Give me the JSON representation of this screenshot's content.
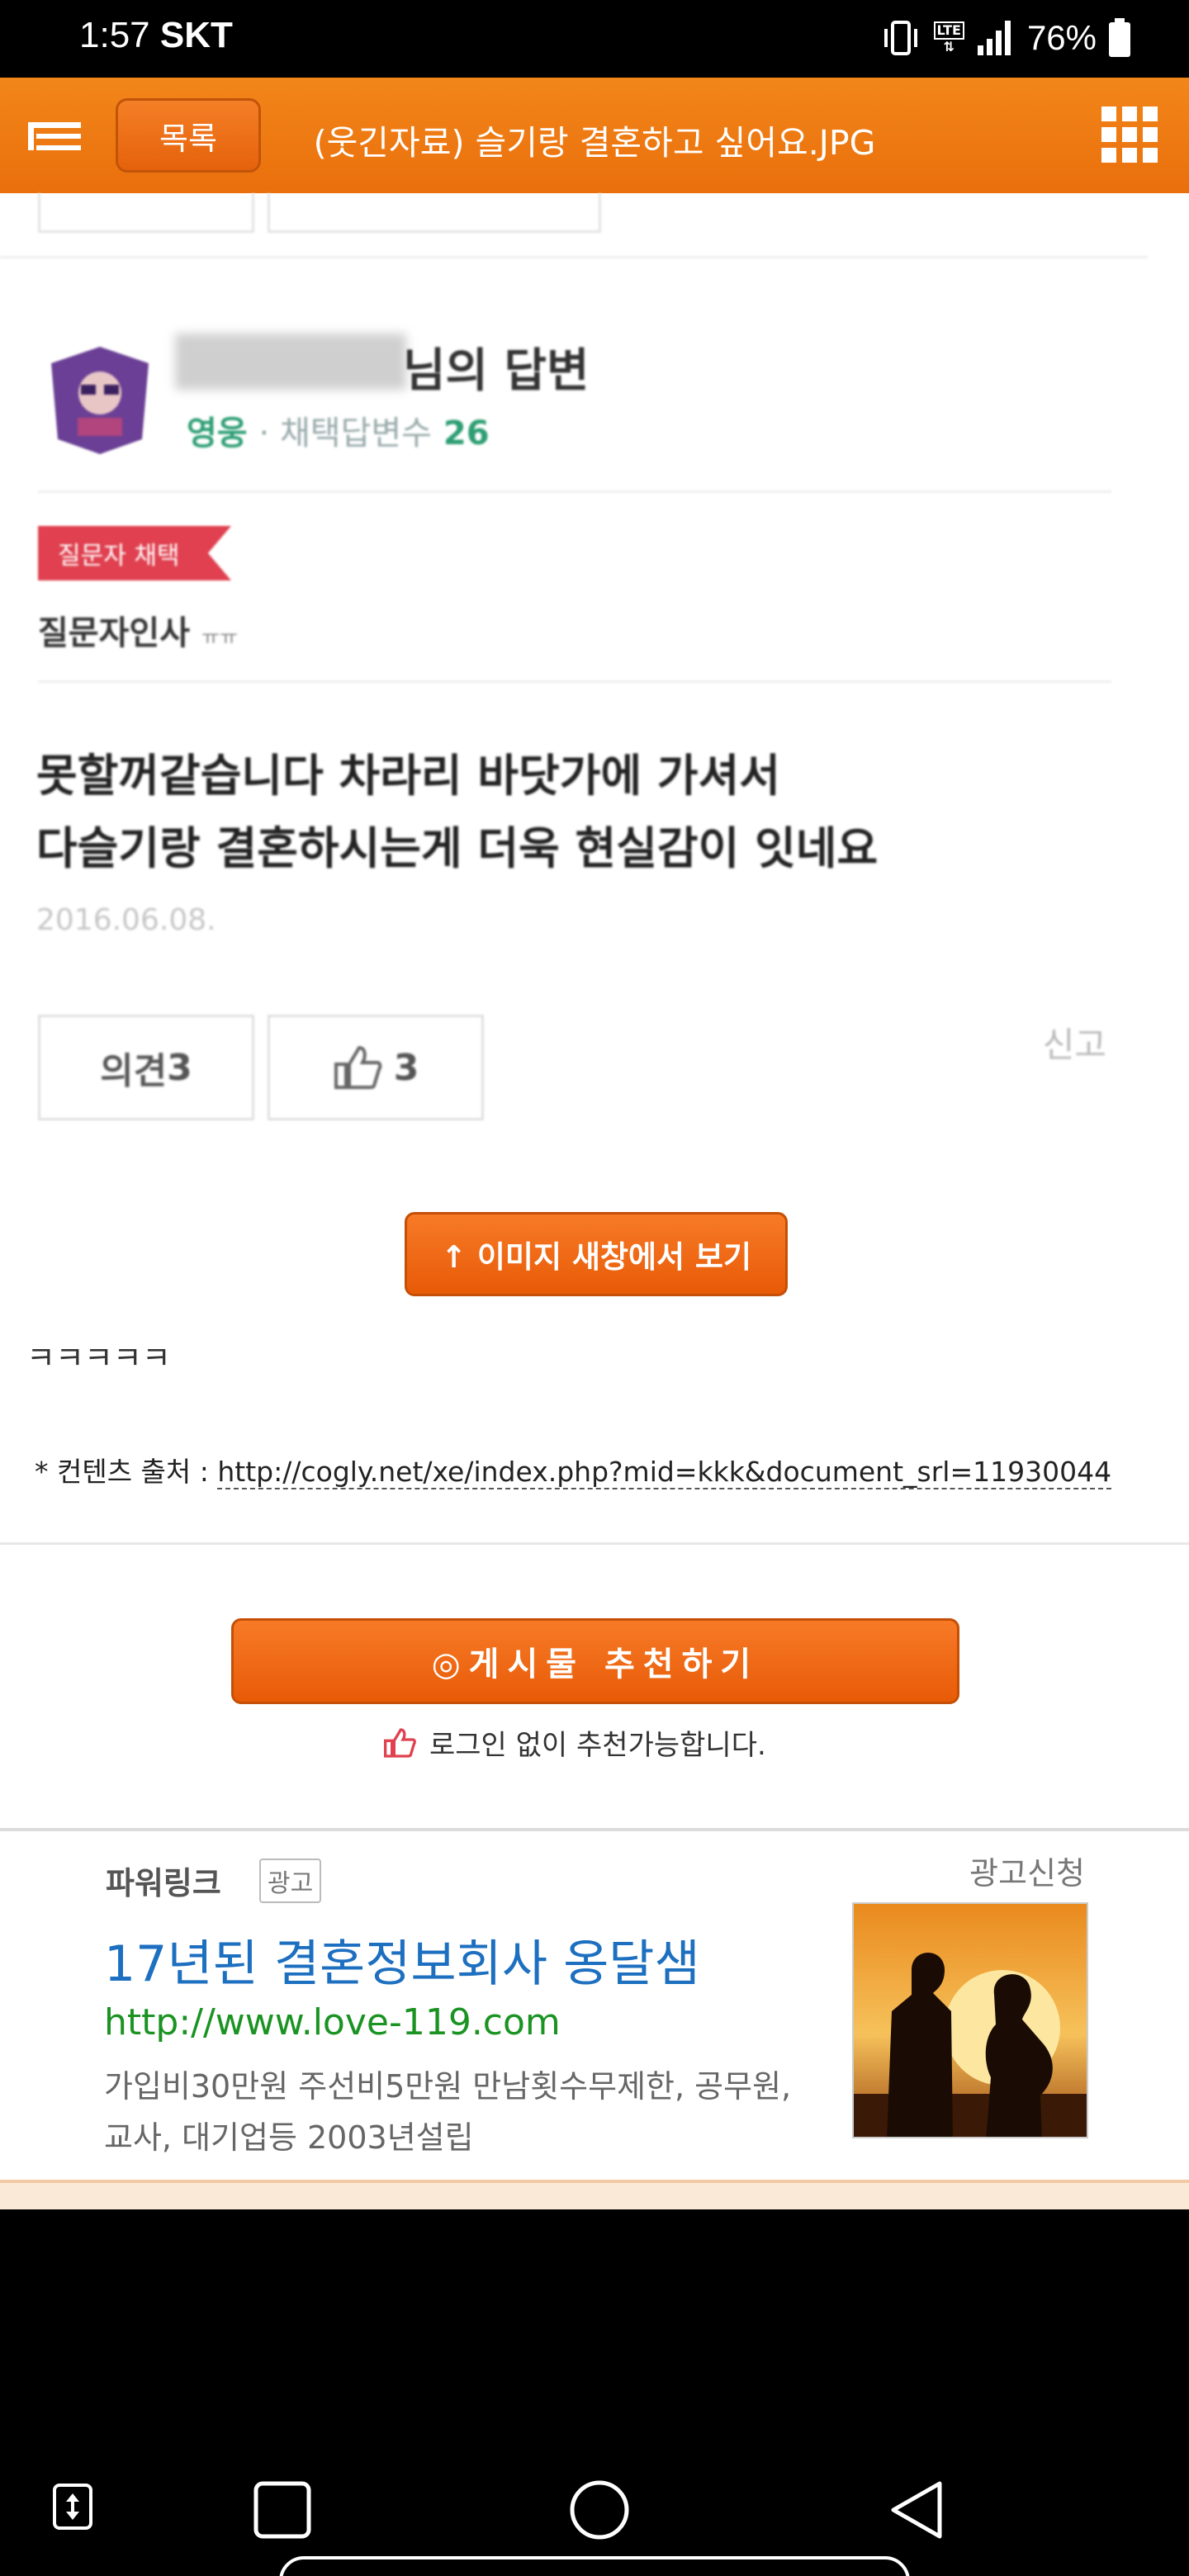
{
  "status_bar": {
    "time": "1:57",
    "carrier": "SKT",
    "network": "LTE",
    "battery": "76%"
  },
  "topbar": {
    "list_label": "목록",
    "title": "(웃긴자료) 슬기랑 결혼하고 싶어요.JPG"
  },
  "answer_card": {
    "name_suffix": "님의 답변",
    "rank": "영웅",
    "selected_count_label": "· 채택답변수",
    "selected_count": "26",
    "ribbon": "질문자 채택",
    "greeting": "질문자인사",
    "greeting_extra": "ㅠㅠ",
    "answer_line1": "못할꺼같습니다 차라리 바닷가에 가셔서",
    "answer_line2": "다슬기랑 결혼하시는게 더욱 현실감이 잇네요",
    "date": "2016.06.08.",
    "opinion_label": "의견",
    "opinion_count": "3",
    "like_count": "3",
    "report": "신고"
  },
  "post": {
    "open_image_button": "↑ 이미지 새창에서 보기",
    "body_text": "ㅋㅋㅋㅋㅋ",
    "source_label": "* 컨텐츠 출처 : ",
    "source_url": "http://cogly.net/xe/index.php?mid=kkk&document_srl=11930044",
    "recommend_button": "◎게시물  추천하기",
    "recommend_note": "로그인 없이 추천가능합니다."
  },
  "ad": {
    "label": "파워링크",
    "badge": "광고",
    "request": "광고신청",
    "title": "17년된 결혼정보회사 옹달샘",
    "url": "http://www.love-119.com",
    "desc_line1": "가입비30만원 주선비5만원 만남횟수무제한, 공무원,",
    "desc_line2": "교사, 대기업등 2003년설립"
  },
  "colors": {
    "accent_orange": "#ea6f0c",
    "ad_title_blue": "#1d6fc0",
    "ad_url_green": "#1a9322",
    "ribbon_red": "#e0404f",
    "rank_green": "#2d9e73"
  }
}
